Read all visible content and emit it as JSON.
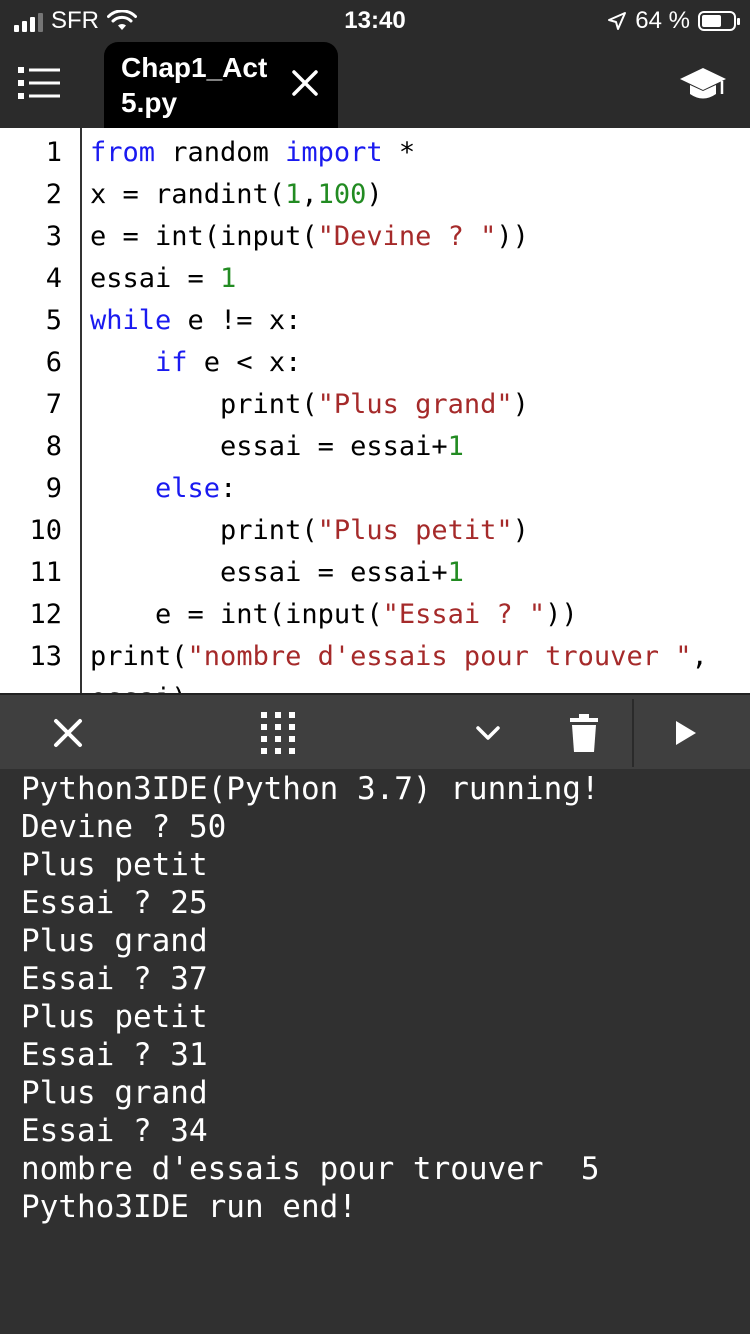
{
  "status_bar": {
    "carrier": "SFR",
    "time": "13:40",
    "battery_percent": "64 %",
    "battery_level": 0.64
  },
  "tab": {
    "title_line1": "Chap1_Act",
    "title_line2": "5.py"
  },
  "editor": {
    "line_numbers": [
      "1",
      "2",
      "3",
      "4",
      "5",
      "6",
      "7",
      "8",
      "9",
      "10",
      "11",
      "12",
      "13"
    ],
    "lines": [
      [
        {
          "t": "kw",
          "s": "from"
        },
        {
          "t": "p",
          "s": " random "
        },
        {
          "t": "kw",
          "s": "import"
        },
        {
          "t": "p",
          "s": " *"
        }
      ],
      [
        {
          "t": "p",
          "s": "x = randint("
        },
        {
          "t": "num",
          "s": "1"
        },
        {
          "t": "p",
          "s": ","
        },
        {
          "t": "num",
          "s": "100"
        },
        {
          "t": "p",
          "s": ")"
        }
      ],
      [
        {
          "t": "p",
          "s": "e = int(input("
        },
        {
          "t": "str",
          "s": "\"Devine ? \""
        },
        {
          "t": "p",
          "s": "))"
        }
      ],
      [
        {
          "t": "p",
          "s": "essai = "
        },
        {
          "t": "num",
          "s": "1"
        }
      ],
      [
        {
          "t": "kw",
          "s": "while"
        },
        {
          "t": "p",
          "s": " e != x:"
        }
      ],
      [
        {
          "t": "p",
          "s": "    "
        },
        {
          "t": "kw",
          "s": "if"
        },
        {
          "t": "p",
          "s": " e < x:"
        }
      ],
      [
        {
          "t": "p",
          "s": "        print("
        },
        {
          "t": "str",
          "s": "\"Plus grand\""
        },
        {
          "t": "p",
          "s": ")"
        }
      ],
      [
        {
          "t": "p",
          "s": "        essai = essai+"
        },
        {
          "t": "num",
          "s": "1"
        }
      ],
      [
        {
          "t": "p",
          "s": "    "
        },
        {
          "t": "kw",
          "s": "else"
        },
        {
          "t": "p",
          "s": ":"
        }
      ],
      [
        {
          "t": "p",
          "s": "        print("
        },
        {
          "t": "str",
          "s": "\"Plus petit\""
        },
        {
          "t": "p",
          "s": ")"
        }
      ],
      [
        {
          "t": "p",
          "s": "        essai = essai+"
        },
        {
          "t": "num",
          "s": "1"
        }
      ],
      [
        {
          "t": "p",
          "s": "    e = int(input("
        },
        {
          "t": "str",
          "s": "\"Essai ? \""
        },
        {
          "t": "p",
          "s": "))"
        }
      ],
      [
        {
          "t": "p",
          "s": "print("
        },
        {
          "t": "str",
          "s": "\"nombre d'essais pour trouver \""
        },
        {
          "t": "p",
          "s": ","
        }
      ]
    ],
    "overflow_line": "essai)"
  },
  "console": {
    "output": [
      "Python3IDE(Python 3.7) running!",
      "Devine ? 50",
      "Plus petit",
      "Essai ? 25",
      "Plus grand",
      "Essai ? 37",
      "Plus petit",
      "Essai ? 31",
      "Plus grand",
      "Essai ? 34",
      "nombre d'essais pour trouver  5",
      "Pytho3IDE run end!"
    ]
  },
  "colors": {
    "keyword": "#1a1af0",
    "number": "#228b22",
    "string": "#a52a2a",
    "toolbar_bg": "#3f3f3f",
    "console_bg": "#303030"
  }
}
